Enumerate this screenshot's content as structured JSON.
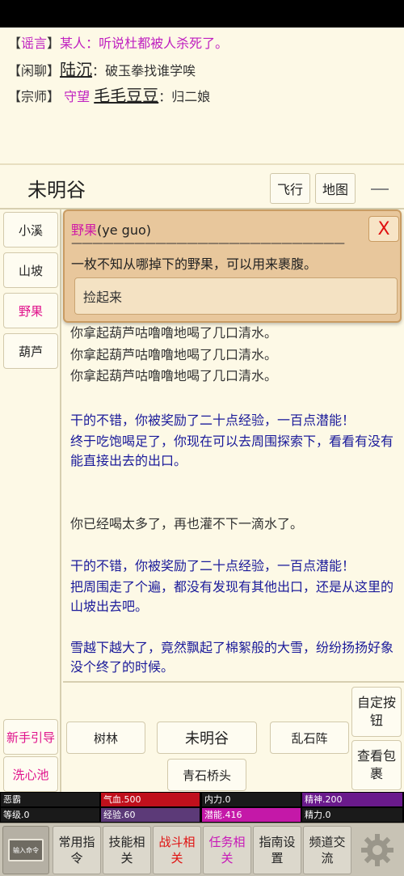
{
  "chat": [
    {
      "channel": "谣言",
      "speaker": "某人",
      "sep": "：",
      "message": "听说杜都被人杀死了。"
    },
    {
      "channel": "闲聊",
      "speaker": "陆沉",
      "sep": "：",
      "message": "破玉拳找谁学唉"
    },
    {
      "channel": "宗师",
      "title": "守望",
      "speaker": "毛毛豆豆",
      "sep": "：",
      "message": "归二娘"
    }
  ],
  "header": {
    "room": "未明谷",
    "fly_label": "飞行",
    "map_label": "地图"
  },
  "sidebar": {
    "objects": [
      "小溪",
      "山坡",
      "野果",
      "葫芦"
    ],
    "guide_label": "新手引导",
    "wash_label": "洗心池"
  },
  "popup": {
    "name": "野果",
    "pinyin": "(ye guo)",
    "rule": "——————————————————————————",
    "description": "一枚不知从哪掉下的野果，可以用来裹腹。",
    "close_label": "X",
    "action_label": "捡起来"
  },
  "log": [
    {
      "text": "你拿起葫芦咕噜噜地喝了几口清水。",
      "style": "dark"
    },
    {
      "text": "你拿起葫芦咕噜噜地喝了几口清水。",
      "style": "dark"
    },
    {
      "text": "你拿起葫芦咕噜噜地喝了几口清水。",
      "style": "dark"
    },
    {
      "text": "干的不错，你被奖励了二十点经验，一百点潜能！",
      "style": "blue"
    },
    {
      "text": "终于吃饱喝足了，你现在可以去周围探索下，看看有没有能直接出去的出口。",
      "style": "blue"
    },
    {
      "text": "你已经喝太多了，再也灌不下一滴水了。",
      "style": "dark"
    },
    {
      "text": "干的不错，你被奖励了二十点经验，一百点潜能！",
      "style": "blue"
    },
    {
      "text": "把周围走了个遍，都没有发现有其他出口，还是从这里的山坡出去吧。",
      "style": "blue"
    },
    {
      "text": "雪越下越大了，竟然飘起了棉絮般的大雪，纷纷扬扬好象没个终了的时候。",
      "style": "blue"
    }
  ],
  "exits": {
    "west": "树林",
    "center": "未明谷",
    "east": "乱石阵",
    "south": "青石桥头"
  },
  "side_buttons": {
    "customize": "自定按钮",
    "inventory": "查看包裹"
  },
  "stats": {
    "alignment": "恶霸",
    "hp": "气血.500",
    "neili": "内力.0",
    "jingshen": "精神.200",
    "level": "等级.0",
    "exp": "经验.60",
    "potential": "潜能.416",
    "jingli": "精力.0"
  },
  "tabs": [
    "常用指令",
    "技能相关",
    "战斗相关",
    "任务相关",
    "指南设置",
    "频道交流"
  ],
  "logo_text": "输入命令",
  "colors": {
    "pink": "#e0128c",
    "blue": "#1a1a9a",
    "red": "#d01010",
    "panel": "#e8c79c"
  }
}
